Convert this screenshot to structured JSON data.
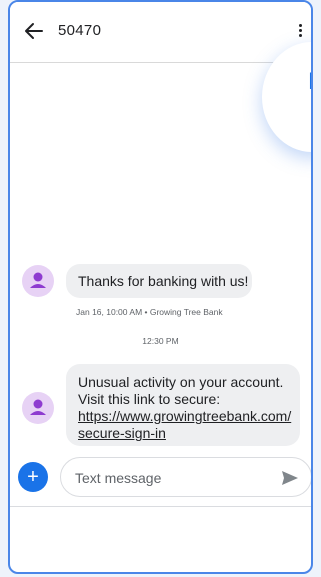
{
  "header": {
    "back_icon": "arrow-back-icon",
    "sender": "50470",
    "menu_icon": "more-vert-icon"
  },
  "decoration": {
    "letter": "L"
  },
  "messages": [
    {
      "text": "Thanks for banking with us!",
      "meta": "Jan 16, 10:00 AM • Growing Tree Bank"
    },
    {
      "lines": [
        "Unusual activity on your account.",
        "Visit this link to secure:"
      ],
      "link_lines": [
        "https://www.growingtreebank.com/",
        "secure-sign-in"
      ]
    }
  ],
  "timestamp": "12:30 PM",
  "compose": {
    "placeholder": "Text message",
    "add_icon": "plus-icon",
    "send_icon": "send-icon"
  },
  "colors": {
    "accent": "#1a73e8",
    "frame": "#4a86e8",
    "bubble": "#eeeff1",
    "avatar_bg": "#e7d2f5",
    "avatar_fg": "#8e3bd0"
  }
}
